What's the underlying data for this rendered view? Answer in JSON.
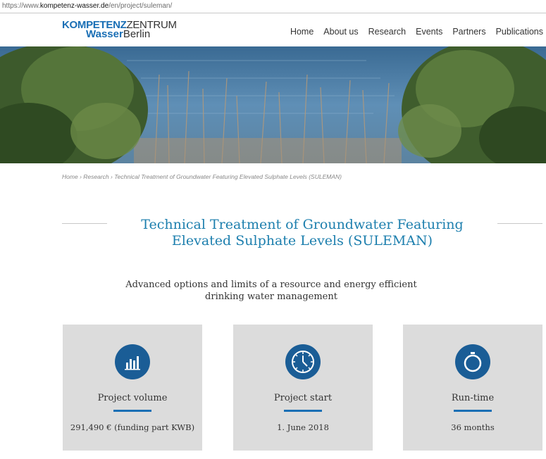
{
  "browser": {
    "url_prefix": "https://www.",
    "url_domain": "kompetenz-wasser.de",
    "url_path": "/en/project/suleman/"
  },
  "logo": {
    "line1_bold": "KOMPETENZ",
    "line1_rest": "ZENTRUM",
    "line2_bold": "Wasser",
    "line2_rest": "Berlin"
  },
  "nav": [
    "Home",
    "About us",
    "Research",
    "Events",
    "Partners",
    "Publications"
  ],
  "breadcrumb": {
    "home": "Home",
    "sep": "›",
    "research": "Research",
    "current": "Technical Treatment of Groundwater Featuring Elevated Sulphate Levels (SULEMAN)"
  },
  "page": {
    "title": "Technical Treatment of Groundwater Featuring Elevated Sulphate Levels (SULEMAN)",
    "subtitle": "Advanced options and limits of a resource and energy efficient drinking water management"
  },
  "cards": [
    {
      "icon": "bar-chart-icon",
      "label": "Project volume",
      "value": "291,490 € (funding part KWB)"
    },
    {
      "icon": "clock-icon",
      "label": "Project start",
      "value": "1. June 2018"
    },
    {
      "icon": "stopwatch-icon",
      "label": "Run-time",
      "value": "36 months"
    }
  ],
  "colors": {
    "title": "#1d7fae",
    "accent": "#1a6fb5",
    "icon_circle": "#1a5d96",
    "card_bg": "#dcdcdc"
  }
}
